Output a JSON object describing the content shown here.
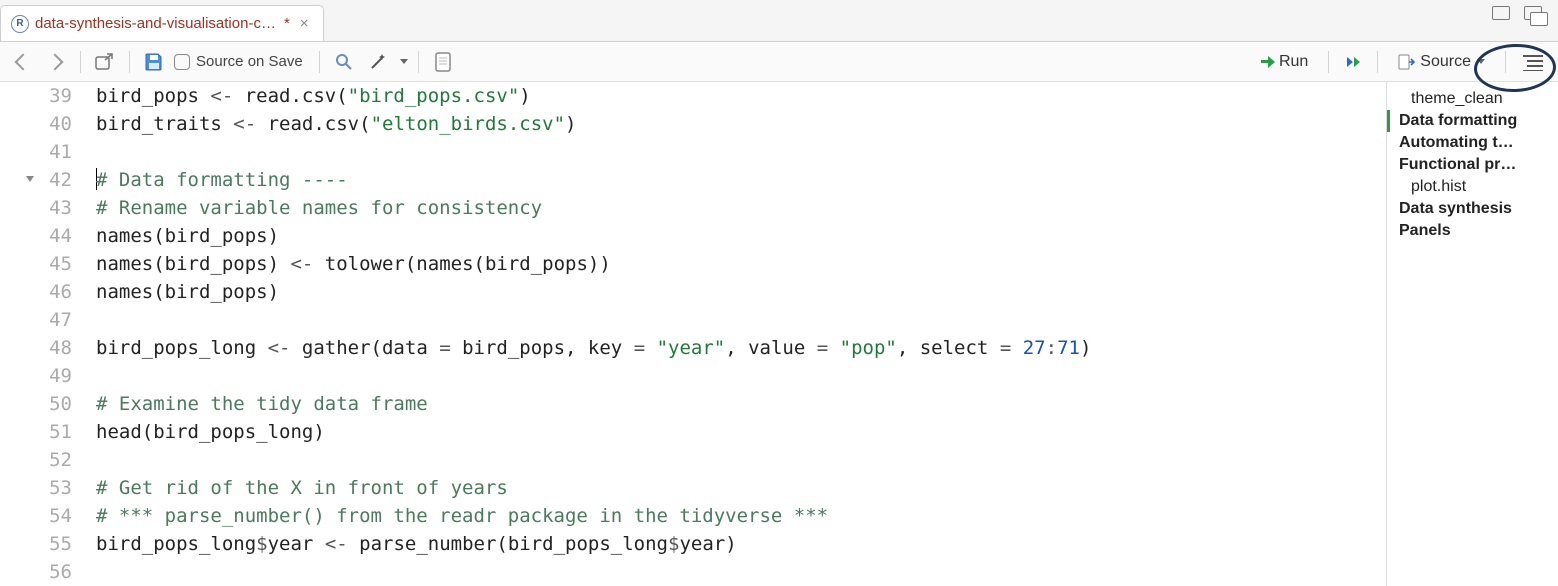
{
  "tab": {
    "title": "data-synthesis-and-visualisation-c…",
    "dirty_marker": "*",
    "close_glyph": "×"
  },
  "toolbar": {
    "source_on_save_label": "Source on Save",
    "run_label": "Run",
    "source_label": "Source"
  },
  "outline_current_index": 1,
  "outline": [
    {
      "label": "theme_clean",
      "kind": "fn"
    },
    {
      "label": "Data formatting",
      "kind": "section"
    },
    {
      "label": "Automating t…",
      "kind": "section"
    },
    {
      "label": "Functional pr…",
      "kind": "section"
    },
    {
      "label": "plot.hist",
      "kind": "fn"
    },
    {
      "label": "Data synthesis",
      "kind": "section"
    },
    {
      "label": "Panels",
      "kind": "section"
    }
  ],
  "code": {
    "first_line": 39,
    "fold_line": 42,
    "cursor_line": 42,
    "lines": [
      {
        "tokens": [
          {
            "t": "bird_pops ",
            "c": "fn"
          },
          {
            "t": "<-",
            "c": "op"
          },
          {
            "t": " read.csv(",
            "c": "fn"
          },
          {
            "t": "\"bird_pops.csv\"",
            "c": "str"
          },
          {
            "t": ")",
            "c": "fn"
          }
        ]
      },
      {
        "tokens": [
          {
            "t": "bird_traits ",
            "c": "fn"
          },
          {
            "t": "<-",
            "c": "op"
          },
          {
            "t": " read.csv(",
            "c": "fn"
          },
          {
            "t": "\"elton_birds.csv\"",
            "c": "str"
          },
          {
            "t": ")",
            "c": "fn"
          }
        ]
      },
      {
        "tokens": []
      },
      {
        "tokens": [
          {
            "t": "# Data formatting ----",
            "c": "cmt"
          }
        ]
      },
      {
        "tokens": [
          {
            "t": "# Rename variable names for consistency",
            "c": "cmt"
          }
        ]
      },
      {
        "tokens": [
          {
            "t": "names(bird_pops)",
            "c": "fn"
          }
        ]
      },
      {
        "tokens": [
          {
            "t": "names(bird_pops) ",
            "c": "fn"
          },
          {
            "t": "<-",
            "c": "op"
          },
          {
            "t": " tolower(names(bird_pops))",
            "c": "fn"
          }
        ]
      },
      {
        "tokens": [
          {
            "t": "names(bird_pops)",
            "c": "fn"
          }
        ]
      },
      {
        "tokens": []
      },
      {
        "tokens": [
          {
            "t": "bird_pops_long ",
            "c": "fn"
          },
          {
            "t": "<-",
            "c": "op"
          },
          {
            "t": " gather(data ",
            "c": "fn"
          },
          {
            "t": "=",
            "c": "op"
          },
          {
            "t": " bird_pops, key ",
            "c": "fn"
          },
          {
            "t": "=",
            "c": "op"
          },
          {
            "t": " ",
            "c": "fn"
          },
          {
            "t": "\"year\"",
            "c": "str"
          },
          {
            "t": ", value ",
            "c": "fn"
          },
          {
            "t": "=",
            "c": "op"
          },
          {
            "t": " ",
            "c": "fn"
          },
          {
            "t": "\"pop\"",
            "c": "str"
          },
          {
            "t": ", select ",
            "c": "fn"
          },
          {
            "t": "=",
            "c": "op"
          },
          {
            "t": " ",
            "c": "fn"
          },
          {
            "t": "27",
            "c": "num"
          },
          {
            "t": ":",
            "c": "op"
          },
          {
            "t": "71",
            "c": "num"
          },
          {
            "t": ")",
            "c": "fn"
          }
        ]
      },
      {
        "tokens": []
      },
      {
        "tokens": [
          {
            "t": "# Examine the tidy data frame",
            "c": "cmt"
          }
        ]
      },
      {
        "tokens": [
          {
            "t": "head(bird_pops_long)",
            "c": "fn"
          }
        ]
      },
      {
        "tokens": []
      },
      {
        "tokens": [
          {
            "t": "# Get rid of the X in front of years",
            "c": "cmt"
          }
        ]
      },
      {
        "tokens": [
          {
            "t": "# *** parse_number() from the readr package in the tidyverse ***",
            "c": "cmt"
          }
        ]
      },
      {
        "tokens": [
          {
            "t": "bird_pops_long",
            "c": "fn"
          },
          {
            "t": "$",
            "c": "op"
          },
          {
            "t": "year ",
            "c": "fn"
          },
          {
            "t": "<-",
            "c": "op"
          },
          {
            "t": " parse_number(bird_pops_long",
            "c": "fn"
          },
          {
            "t": "$",
            "c": "op"
          },
          {
            "t": "year)",
            "c": "fn"
          }
        ]
      },
      {
        "tokens": []
      }
    ]
  }
}
